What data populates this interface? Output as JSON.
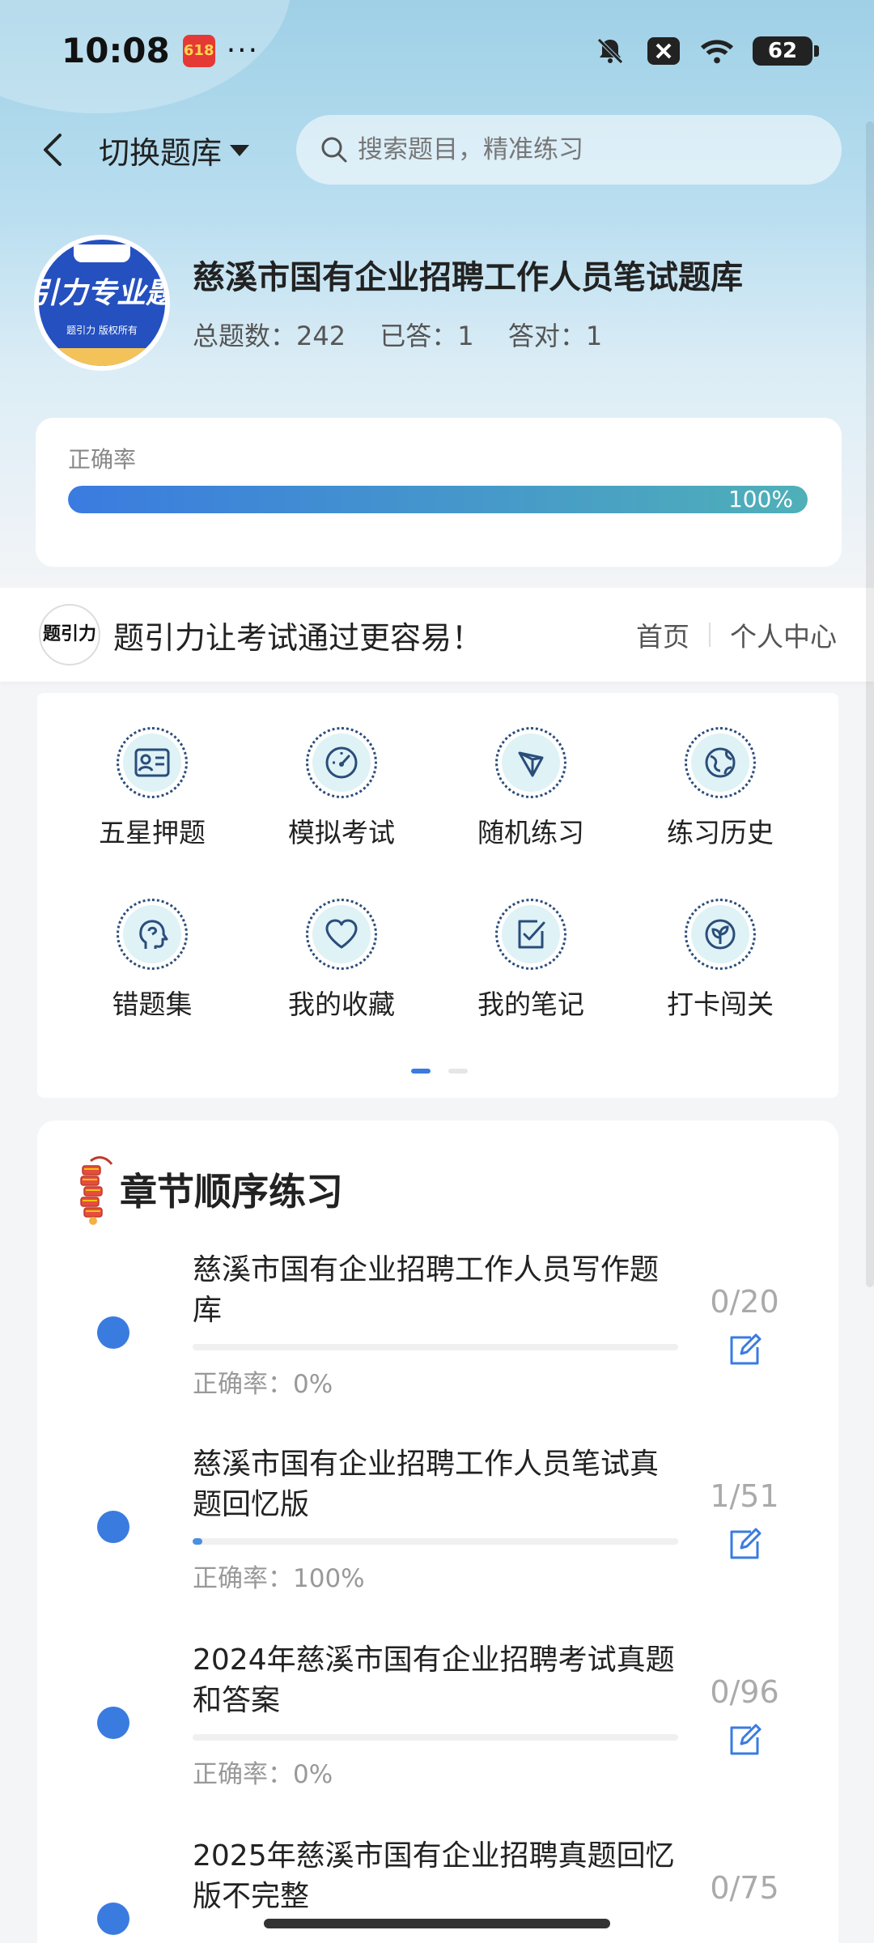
{
  "status_bar": {
    "time": "10:08",
    "app_badge": "618",
    "more_dots": "···",
    "battery": "62"
  },
  "nav": {
    "switch_bank": "切换题库",
    "search_placeholder": "搜索题目，精准练习"
  },
  "bank": {
    "logo_text": "引力专业题",
    "logo_subtext": "题引力 版权所有",
    "title": "慈溪市国有企业招聘工作人员笔试题库",
    "total": "总题数：242",
    "answered": "已答：1",
    "correct": "答对：1"
  },
  "accuracy": {
    "label": "正确率",
    "value_text": "100%",
    "value_fraction": 1.0
  },
  "promo": {
    "logo_text": "题引力",
    "slogan": "题引力让考试通过更容易！",
    "home": "首页",
    "profile": "个人中心"
  },
  "grid": [
    {
      "label": "五星押题",
      "icon": "id-card-icon"
    },
    {
      "label": "模拟考试",
      "icon": "speedometer-icon"
    },
    {
      "label": "随机练习",
      "icon": "shuffle-icon"
    },
    {
      "label": "练习历史",
      "icon": "globe-icon"
    },
    {
      "label": "错题集",
      "icon": "head-icon"
    },
    {
      "label": "我的收藏",
      "icon": "heart-icon"
    },
    {
      "label": "我的笔记",
      "icon": "note-check-icon"
    },
    {
      "label": "打卡闯关",
      "icon": "sprout-icon"
    }
  ],
  "chapters": {
    "title": "章节顺序练习",
    "items": [
      {
        "name": "慈溪市国有企业招聘工作人员写作题库",
        "accuracy": "正确率：0%",
        "count": "0/20",
        "progress_fraction": 0.0
      },
      {
        "name": "慈溪市国有企业招聘工作人员笔试真题回忆版",
        "accuracy": "正确率：100%",
        "count": "1/51",
        "progress_fraction": 0.0196
      },
      {
        "name": "2024年慈溪市国有企业招聘考试真题和答案",
        "accuracy": "正确率：0%",
        "count": "0/96",
        "progress_fraction": 0.0
      },
      {
        "name": "2025年慈溪市国有企业招聘真题回忆版不完整",
        "accuracy": "",
        "count": "0/75",
        "progress_fraction": 0.0
      }
    ]
  },
  "colors": {
    "accent": "#3a7be0",
    "progress_end": "#4fb0b8",
    "icon_bg": "#dff2f6",
    "icon_stroke": "#2a4d7a"
  }
}
